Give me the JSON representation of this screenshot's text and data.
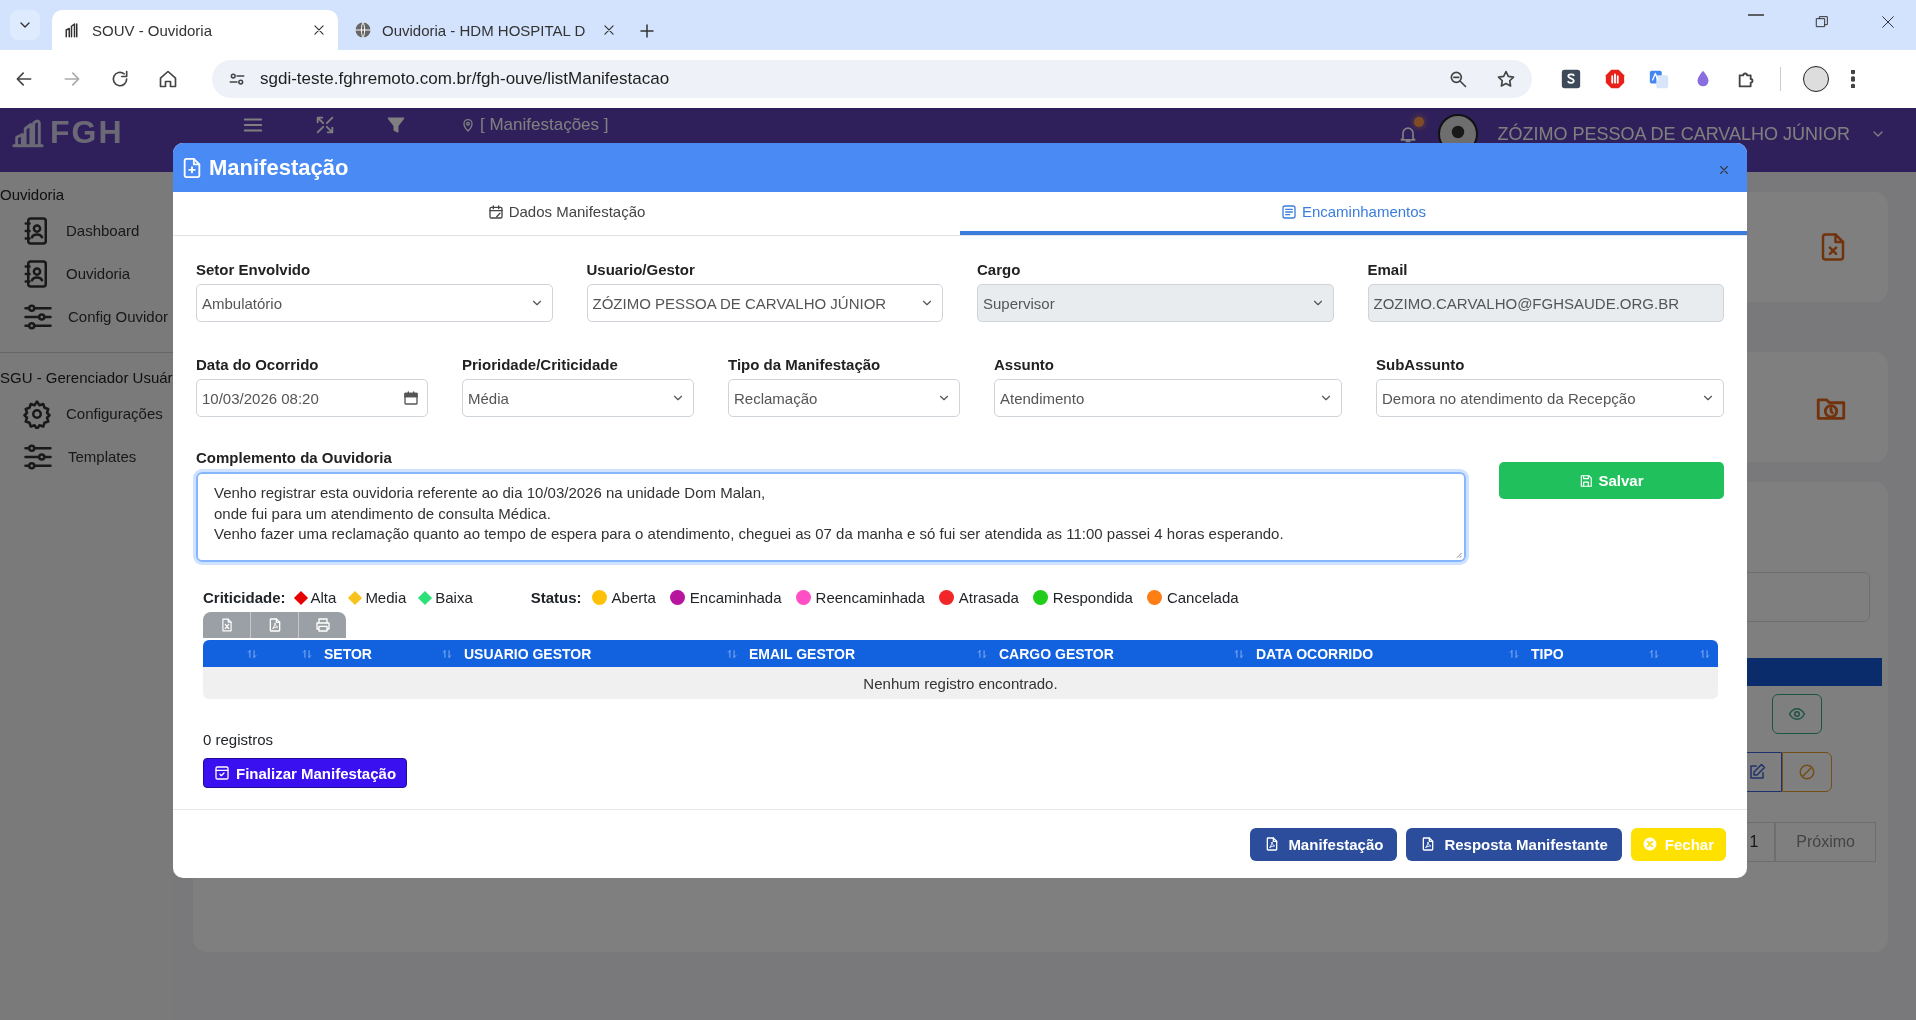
{
  "browser": {
    "tabs": [
      {
        "title": "SOUV - Ouvidoria",
        "selected": true
      },
      {
        "title": "Ouvidoria - HDM HOSPITAL D",
        "selected": false
      }
    ],
    "url": "sgdi-teste.fghremoto.com.br/fgh-ouve/listManifestacao"
  },
  "app": {
    "logo": "FGH",
    "breadcrumb": "[ Manifestações ]",
    "user": "ZÓZIMO PESSOA DE CARVALHO JÚNIOR",
    "sidebar": [
      {
        "title": "Ouvidoria",
        "items": [
          {
            "label": "Dashboard",
            "kind": "contact"
          },
          {
            "label": "Ouvidoria",
            "kind": "contact"
          },
          {
            "label": "Config Ouvidor",
            "kind": "sliders"
          }
        ]
      },
      {
        "title": "SGU - Gerenciador Usuár",
        "items": [
          {
            "label": "Configurações",
            "kind": "gear"
          },
          {
            "label": "Templates",
            "kind": "sliders"
          }
        ]
      }
    ],
    "pagination": {
      "page": "1",
      "next": "Próximo"
    }
  },
  "modal": {
    "title": "Manifestação",
    "tabs": [
      {
        "label": "Dados Manifestação",
        "selected": false
      },
      {
        "label": "Encaminhamentos",
        "selected": true
      }
    ],
    "field_rows": [
      [
        {
          "label": "Setor Envolvido",
          "value": "Ambulatório",
          "kind": "select",
          "disabled": false
        },
        {
          "label": "Usuario/Gestor",
          "value": "ZÓZIMO PESSOA DE CARVALHO JÚNIOR",
          "kind": "select",
          "disabled": false
        },
        {
          "label": "Cargo",
          "value": "Supervisor",
          "kind": "select",
          "disabled": true
        },
        {
          "label": "Email",
          "value": "ZOZIMO.CARVALHO@FGHSAUDE.ORG.BR",
          "kind": "text",
          "disabled": true
        }
      ],
      [
        {
          "label": "Data do Ocorrido",
          "value": "10/03/2026 08:20",
          "kind": "date",
          "disabled": false
        },
        {
          "label": "Prioridade/Criticidade",
          "value": "Média",
          "kind": "select",
          "disabled": false
        },
        {
          "label": "Tipo da Manifestação",
          "value": "Reclamação",
          "kind": "select",
          "disabled": false
        },
        {
          "label": "Assunto",
          "value": "Atendimento",
          "kind": "select",
          "disabled": false
        },
        {
          "label": "SubAssunto",
          "value": "Demora no atendimento da Recepção",
          "kind": "select",
          "disabled": false
        }
      ]
    ],
    "complement": {
      "label": "Complemento da Ouvidoria",
      "value": "Venho registrar esta ouvidoria referente ao dia 10/03/2026 na unidade Dom Malan,\nonde fui para um atendimento de consulta Médica.\nVenho fazer uma reclamação quanto ao tempo de espera para o atendimento, cheguei as 07 da manha e só fui ser atendida as 11:00 passei 4 horas esperando."
    },
    "save_button": "Salvar",
    "criticality": {
      "label": "Criticidade:",
      "items": [
        {
          "label": "Alta",
          "color": "#e60000"
        },
        {
          "label": "Media",
          "color": "#f7c21b"
        },
        {
          "label": "Baixa",
          "color": "#2ee07a"
        }
      ]
    },
    "status": {
      "label": "Status:",
      "items": [
        {
          "label": "Aberta",
          "color": "#ffc107"
        },
        {
          "label": "Encaminhada",
          "color": "#b8159f"
        },
        {
          "label": "Reencaminhada",
          "color": "#ff4fc4"
        },
        {
          "label": "Atrasada",
          "color": "#f22628"
        },
        {
          "label": "Respondida",
          "color": "#22cc1a"
        },
        {
          "label": "Cancelada",
          "color": "#fd7e14"
        }
      ]
    },
    "table": {
      "columns": [
        "SETOR",
        "USUARIO GESTOR",
        "EMAIL GESTOR",
        "CARGO GESTOR",
        "DATA OCORRIDO",
        "TIPO"
      ],
      "empty_message": "Nenhum registro encontrado."
    },
    "record_count": "0 registros",
    "finalize_button": "Finalizar Manifestação",
    "footer_buttons": [
      {
        "label": "Manifestação",
        "kind": "pdf"
      },
      {
        "label": "Resposta Manifestante",
        "kind": "pdf"
      },
      {
        "label": "Fechar",
        "kind": "close"
      }
    ]
  }
}
